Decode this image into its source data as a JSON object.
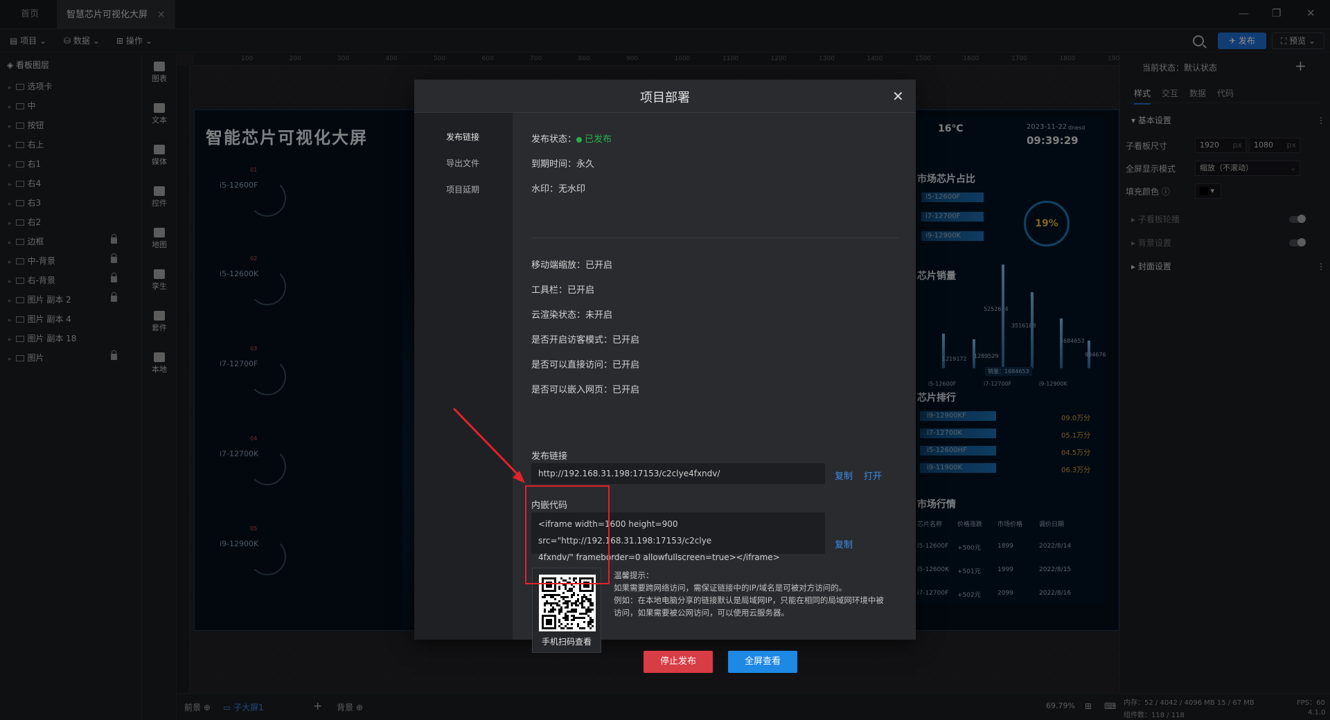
{
  "tabs": {
    "home": "首页",
    "current": "智慧芯片可视化大屏"
  },
  "toolbar": {
    "project": "项目",
    "data": "数据",
    "ops": "操作",
    "publish": "发布",
    "preview": "预览"
  },
  "layers": {
    "title": "看板图层",
    "items": [
      "选项卡",
      "中",
      "按钮",
      "右上",
      "右1",
      "右4",
      "右3",
      "右2",
      "边框",
      "中-背景",
      "右-背景",
      "图片 副本 2",
      "图片 副本 4",
      "图片 副本 18",
      "图片"
    ]
  },
  "rail": [
    "图表",
    "文本",
    "媒体",
    "控件",
    "地图",
    "孪生",
    "套件",
    "本地"
  ],
  "ruler": [
    "100",
    "200",
    "300",
    "400",
    "500",
    "600",
    "700",
    "800",
    "900",
    "1000",
    "1100",
    "1200",
    "1300",
    "1400",
    "1500",
    "1600",
    "1700",
    "1800",
    "1900"
  ],
  "screen": {
    "title": "智能芯片可视化大屏",
    "chips": [
      "i5-12600F",
      "i5-12600K",
      "i7-12700F",
      "i7-12700K",
      "i9-12900K"
    ],
    "chip_nums": [
      "01",
      "02",
      "03",
      "04",
      "05"
    ],
    "weather_temp": "16℃",
    "date": "2023-11-22",
    "day": "dnesd",
    "time": "09:39:29",
    "share_title": "市场芯片占比",
    "share_items": [
      "i5-12600F",
      "i7-12700F",
      "i9-12900K"
    ],
    "share_pct": "19%",
    "sales_title": "芯片销量",
    "sales_values": [
      "5252654",
      "3516188",
      "1219172",
      "1289529",
      "1684653",
      "994676"
    ],
    "sales_tip": "销量：1684653",
    "sales_axis": [
      "i5-12600F",
      "i7-12700F",
      "i9-12900K"
    ],
    "rank_title": "芯片排行",
    "rank": [
      {
        "name": "i9-12900KF",
        "score": "09.0万分"
      },
      {
        "name": "i7-12700K",
        "score": "05.1万分"
      },
      {
        "name": "i5-12600HF",
        "score": "04.5万分"
      },
      {
        "name": "i9-11900K",
        "score": "06.3万分"
      }
    ],
    "market_title": "市场行情",
    "market_cols": [
      "芯片名称",
      "价格涨跌",
      "市场价格",
      "调价日期"
    ],
    "market_rows": [
      [
        "i5-12600F",
        "+500元",
        "1899",
        "2022/8/14"
      ],
      [
        "i5-12600K",
        "+501元",
        "1999",
        "2022/8/15"
      ],
      [
        "i7-12700F",
        "+502元",
        "2099",
        "2022/8/16"
      ]
    ]
  },
  "props": {
    "state": "当前状态：默认状态",
    "tabs": [
      "样式",
      "交互",
      "数据",
      "代码"
    ],
    "basic": "基本设置",
    "size_label": "子看板尺寸",
    "width": "1920",
    "height": "1080",
    "unit": "px",
    "fullscreen_label": "全屏显示模式",
    "fullscreen_value": "缩放（不滚动）",
    "fill_label": "填充颜色",
    "carousel": "子看板轮播",
    "bg": "背景设置",
    "cover": "封面设置"
  },
  "bottom": {
    "front": "前景",
    "sub": "子大屏1",
    "bg": "背景",
    "zoom": "69.79%"
  },
  "status": {
    "mem": "内存：52 / 4042 / 4096 MB  15 / 67 MB",
    "fps": "FPS：60",
    "count": "组件数：118 / 118",
    "ver": "4.1.0"
  },
  "modal": {
    "title": "项目部署",
    "side": [
      "发布链接",
      "导出文件",
      "项目延期"
    ],
    "publish_status_label": "发布状态：",
    "publish_status_value": "已发布",
    "expire": "到期时间：永久",
    "watermark": "水印：无水印",
    "settings": [
      "移动端缩放：已开启",
      "工具栏：已开启",
      "云渲染状态：未开启",
      "是否开启访客模式：已开启",
      "是否可以直接访问：已开启",
      "是否可以嵌入网页：已开启"
    ],
    "link_label": "发布链接",
    "link_value": "http://192.168.31.198:17153/c2clye4fxndv/",
    "copy": "复制",
    "open": "打开",
    "embed_label": "内嵌代码",
    "embed_line1": "<iframe width=1600 height=900 src=\"http://192.168.31.198:17153/c2clye",
    "embed_line2": "4fxndv/\" frameborder=0 allowfullscreen=true></iframe>",
    "qr_caption": "手机扫码查看",
    "hint_title": "温馨提示：",
    "hint1": "如果需要跨网络访问，需保证链接中的IP/域名是可被对方访问的。",
    "hint2": "例如：在本地电脑分享的链接默认是局域网IP，只能在相同的局域网环境中被",
    "hint3": "访问，如果需要被公网访问，可以使用云服务器。",
    "stop": "停止发布",
    "fullview": "全屏查看"
  },
  "colors": {
    "accent": "#1f6fd1",
    "success": "#27b04a",
    "danger": "#d83c44",
    "annotation": "#e3222b"
  }
}
